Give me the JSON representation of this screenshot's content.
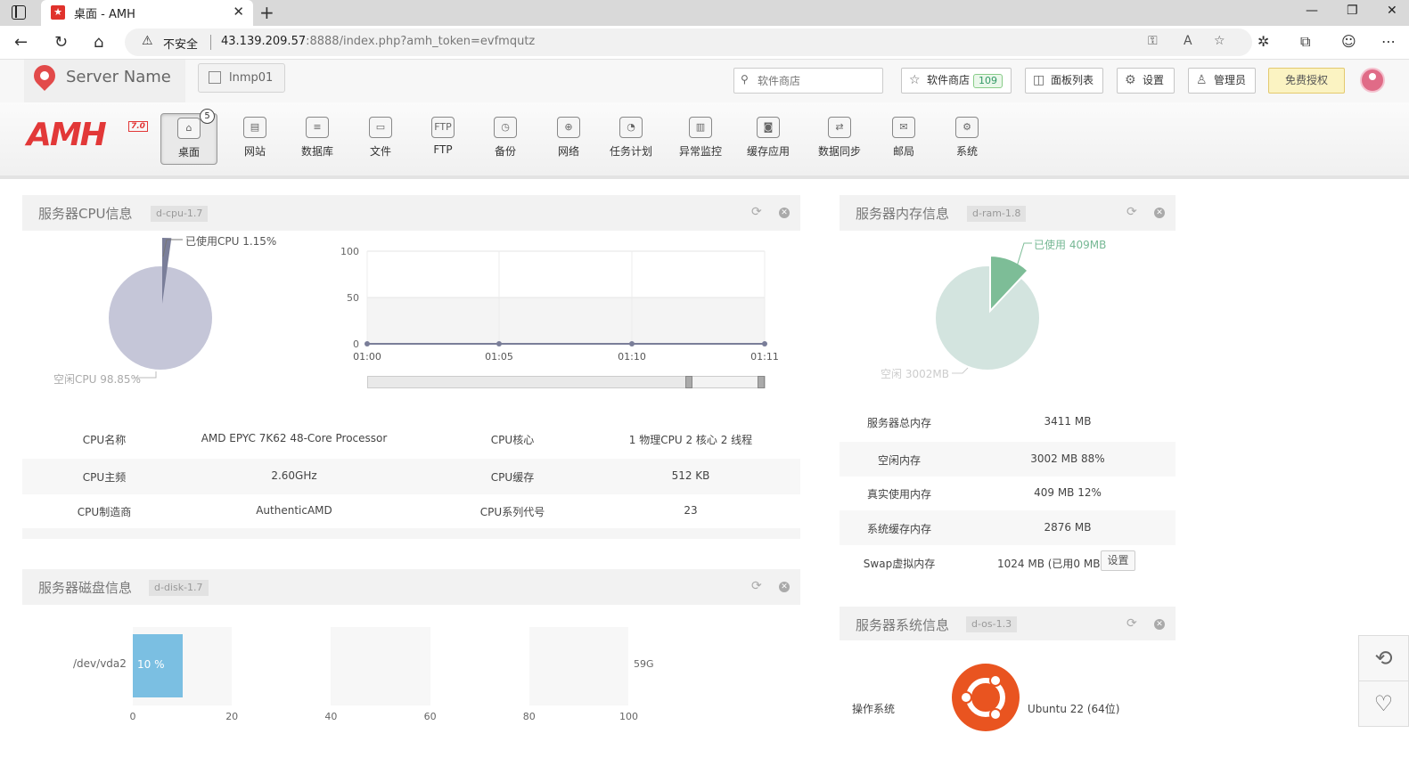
{
  "browser": {
    "tab_title": "桌面 - AMH",
    "insecure_label": "不安全",
    "url_host": "43.139.209.57",
    "url_rest": ":8888/index.php?amh_token=evfmqutz"
  },
  "topbar": {
    "server_name": "Server Name",
    "env_label": "lnmp01",
    "search_placeholder": "软件商店",
    "store_label": "软件商店",
    "store_count": "109",
    "panels_label": "面板列表",
    "settings_label": "设置",
    "admin_label": "管理员",
    "license_label": "免费授权"
  },
  "logo": {
    "text": "AMH",
    "version": "7.0"
  },
  "menu": {
    "items": [
      {
        "label": "桌面",
        "icon": "home-icon"
      },
      {
        "label": "网站",
        "icon": "website-icon"
      },
      {
        "label": "数据库",
        "icon": "database-icon"
      },
      {
        "label": "文件",
        "icon": "folder-icon"
      },
      {
        "label": "FTP",
        "icon": "ftp-icon"
      },
      {
        "label": "备份",
        "icon": "backup-icon"
      },
      {
        "label": "网络",
        "icon": "network-icon"
      },
      {
        "label": "任务计划",
        "icon": "clock-icon"
      },
      {
        "label": "异常监控",
        "icon": "monitor-icon"
      },
      {
        "label": "缓存应用",
        "icon": "cache-icon"
      },
      {
        "label": "数据同步",
        "icon": "sync-icon"
      },
      {
        "label": "邮局",
        "icon": "mail-icon"
      },
      {
        "label": "系统",
        "icon": "system-icon"
      }
    ],
    "desktop_badge": "5"
  },
  "cpu": {
    "title": "服务器CPU信息",
    "tag": "d-cpu-1.7",
    "used_label": "已使用CPU 1.15%",
    "idle_label": "空闲CPU 98.85%",
    "used_pct": 1.15,
    "chart": {
      "y_ticks": [
        "100",
        "50",
        "0"
      ],
      "x_ticks": [
        "01:00",
        "01:05",
        "01:10",
        "01:11"
      ],
      "values": [
        0,
        0,
        0,
        0
      ]
    },
    "rows": [
      [
        "CPU名称",
        "AMD EPYC 7K62 48-Core Processor",
        "CPU核心",
        "1 物理CPU  2 核心  2 线程"
      ],
      [
        "CPU主频",
        "2.60GHz",
        "CPU缓存",
        "512 KB"
      ],
      [
        "CPU制造商",
        "AuthenticAMD",
        "CPU系列代号",
        "23"
      ]
    ]
  },
  "ram": {
    "title": "服务器内存信息",
    "tag": "d-ram-1.8",
    "used_label": "已使用 409MB",
    "idle_label": "空闲 3002MB",
    "used_mb": 409,
    "total_mb": 3411,
    "rows": [
      [
        "服务器总内存",
        "3411 MB"
      ],
      [
        "空闲内存",
        "3002 MB   88%"
      ],
      [
        "真实使用内存",
        "409 MB   12%"
      ],
      [
        "系统缓存内存",
        "2876 MB"
      ],
      [
        "Swap虚拟内存",
        "1024 MB (已用0 MB)"
      ]
    ],
    "swap_btn": "设置"
  },
  "disk": {
    "title": "服务器磁盘信息",
    "tag": "d-disk-1.7",
    "device": "/dev/vda2",
    "pct_label": "10 %",
    "pct": 10,
    "size": "59G",
    "x_ticks": [
      "0",
      "20",
      "40",
      "60",
      "80",
      "100"
    ]
  },
  "os": {
    "title": "服务器系统信息",
    "tag": "d-os-1.3",
    "label": "操作系统",
    "value": "Ubuntu 22 (64位)"
  }
}
